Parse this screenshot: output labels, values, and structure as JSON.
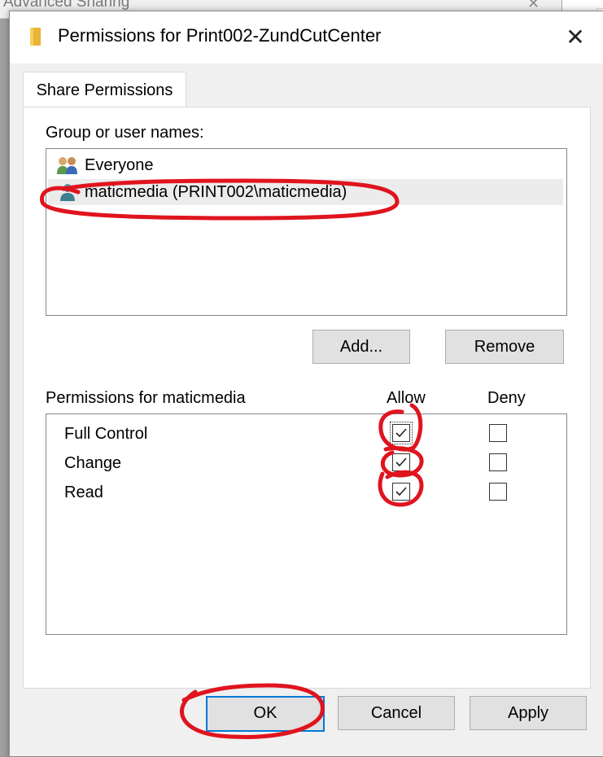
{
  "background": {
    "window_title": "Advanced Sharing"
  },
  "dialog": {
    "title": "Permissions for Print002-ZundCutCenter",
    "close_glyph": "✕"
  },
  "tabs": [
    {
      "label": "Share Permissions",
      "active": true
    }
  ],
  "users_section": {
    "label": "Group or user names:",
    "items": [
      {
        "name": "Everyone",
        "icon": "group-icon",
        "selected": false
      },
      {
        "name": "maticmedia (PRINT002\\maticmedia)",
        "icon": "user-icon",
        "selected": true
      }
    ],
    "add_label": "Add...",
    "remove_label": "Remove"
  },
  "permissions_section": {
    "label": "Permissions for maticmedia",
    "allow_header": "Allow",
    "deny_header": "Deny",
    "rows": [
      {
        "name": "Full Control",
        "allow": true,
        "deny": false
      },
      {
        "name": "Change",
        "allow": true,
        "deny": false
      },
      {
        "name": "Read",
        "allow": true,
        "deny": false
      }
    ]
  },
  "footer": {
    "ok_label": "OK",
    "cancel_label": "Cancel",
    "apply_label": "Apply"
  },
  "colors": {
    "annotation": "#e0141e",
    "accent": "#0078d7",
    "button_face": "#e1e1e1",
    "dialog_bg": "#f0f0f0"
  }
}
